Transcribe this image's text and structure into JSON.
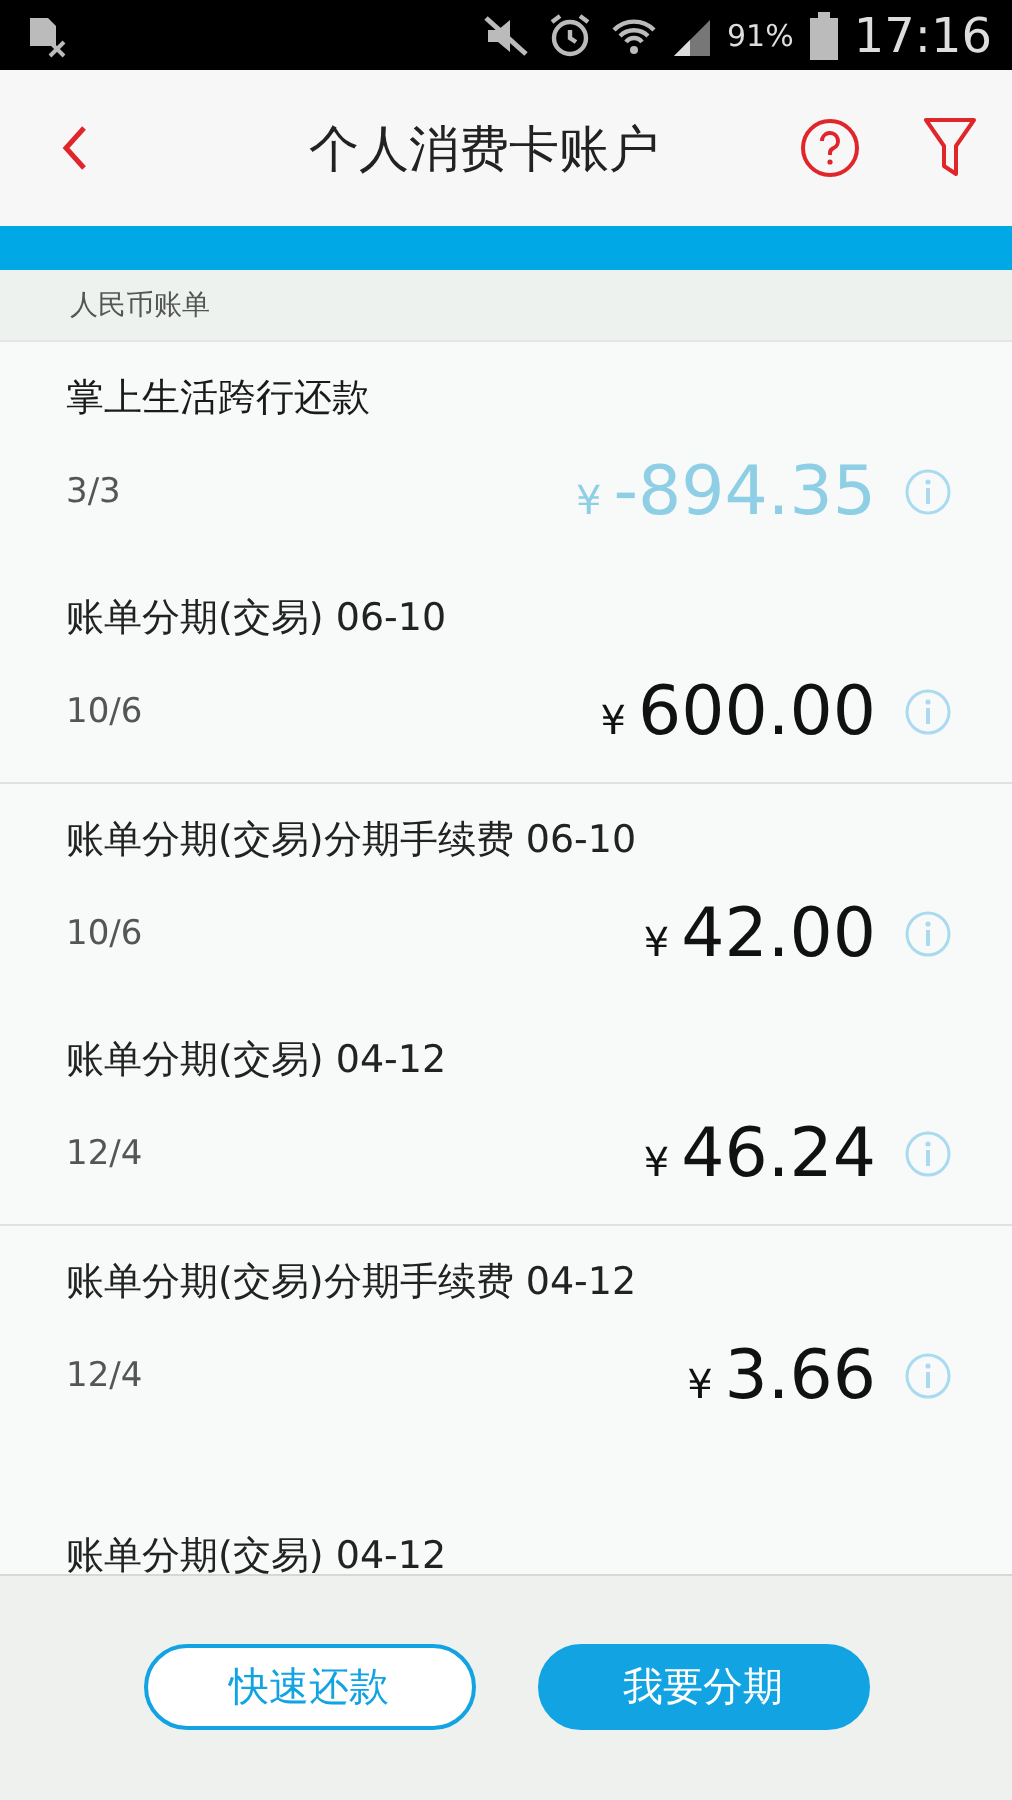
{
  "status_bar": {
    "battery": "91%",
    "time": "17:16"
  },
  "header": {
    "title": "个人消费卡账户"
  },
  "section": {
    "title": "人民币账单"
  },
  "groups": [
    {
      "items": [
        {
          "title": "掌上生活跨行还款",
          "date": "3/3",
          "currency": "¥",
          "amount": "-894.35",
          "kind": "credit"
        },
        {
          "title": "账单分期(交易) 06-10",
          "date": "10/6",
          "currency": "¥",
          "amount": "600.00",
          "kind": "debit"
        }
      ]
    },
    {
      "items": [
        {
          "title": "账单分期(交易)分期手续费 06-10",
          "date": "10/6",
          "currency": "¥",
          "amount": "42.00",
          "kind": "debit"
        },
        {
          "title": "账单分期(交易) 04-12",
          "date": "12/4",
          "currency": "¥",
          "amount": "46.24",
          "kind": "debit"
        }
      ]
    },
    {
      "items": [
        {
          "title": "账单分期(交易)分期手续费 04-12",
          "date": "12/4",
          "currency": "¥",
          "amount": "3.66",
          "kind": "debit"
        },
        {
          "title": "账单分期(交易) 04-12",
          "kind": "debit"
        }
      ]
    }
  ],
  "actions": [
    {
      "label": "快速还款",
      "kind": "outline"
    },
    {
      "label": "我要分期",
      "kind": "filled"
    }
  ]
}
